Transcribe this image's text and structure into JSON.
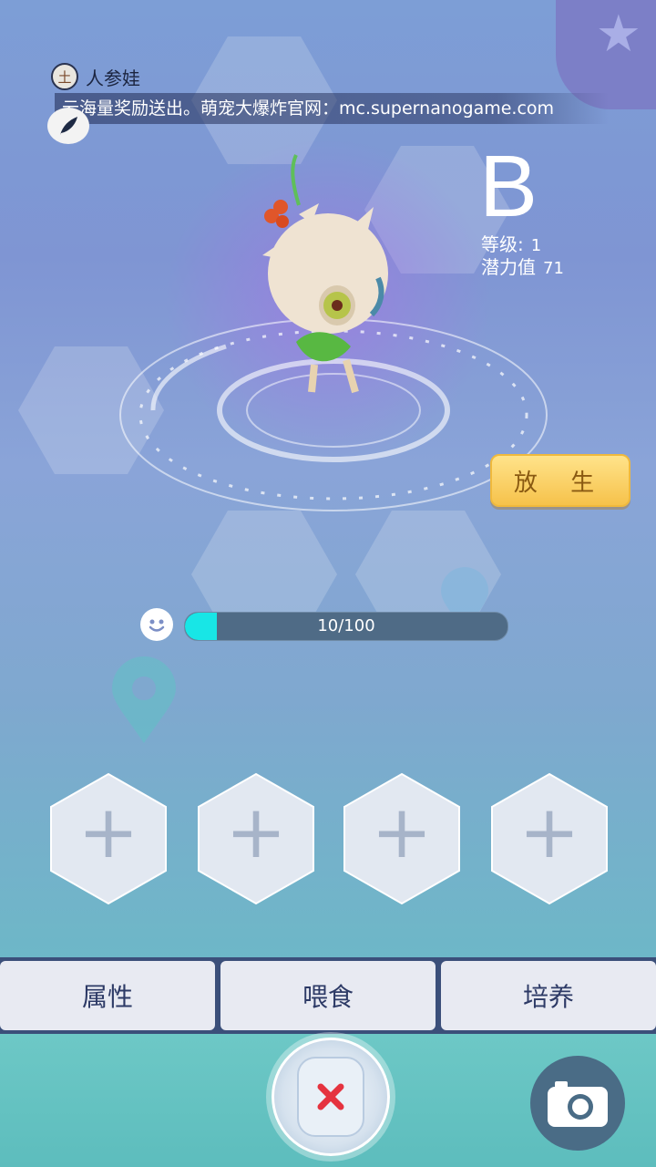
{
  "pet": {
    "element_badge": "土",
    "name": "人参娃",
    "grade": "B",
    "level_label": "等级:",
    "level_value": "1",
    "potential_label": "潜力值",
    "potential_value": "71"
  },
  "announcement": "云海量奖励送出。萌宠大爆炸官网：mc.supernanogame.com",
  "actions": {
    "release_label": "放 生"
  },
  "mood": {
    "value": 10,
    "max": 100,
    "text": "10/100"
  },
  "skill_slots": [
    "+",
    "+",
    "+",
    "+"
  ],
  "tabs": [
    {
      "label": "属性"
    },
    {
      "label": "喂食"
    },
    {
      "label": "培养"
    }
  ],
  "icons": {
    "corner": "star-icon",
    "mood": "smiley-icon",
    "close": "close-x-icon",
    "camera": "camera-icon",
    "leaf": "leaf-icon",
    "pin": "location-pin-icon"
  },
  "colors": {
    "mood_fill": "#18e6e6",
    "release_gold": "#f6c24b",
    "close_red": "#e5333f"
  }
}
